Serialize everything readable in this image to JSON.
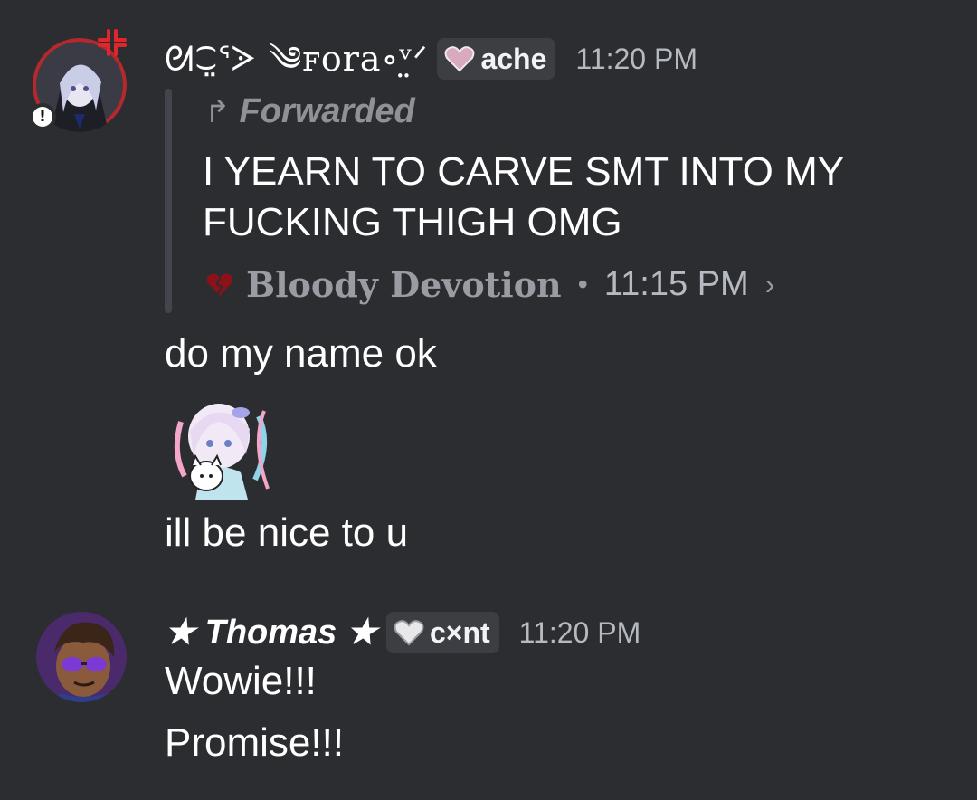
{
  "messages": [
    {
      "username": "ᘛ⁐̤ᕐᐷ ༄ꜰora∘ᵛ̤ᐟ",
      "role_tag": "ache",
      "tag_color": "#d8aabd",
      "timestamp": "11:20 PM",
      "forwarded": {
        "label": "Forwarded",
        "text": "I YEARN TO CARVE SMT INTO MY FUCKING THIGH OMG",
        "source_name": "Bloody Devotion",
        "source_separator": "•",
        "source_time": "11:15 PM",
        "source_chevron": "›",
        "source_icon": "broken-heart-icon"
      },
      "lines": [
        "do my name ok",
        "ill be nice to u"
      ],
      "sticker": "anime-girl-with-cat-sticker",
      "status_icon": "exclamation-icon"
    },
    {
      "username": "★ Thomas ★",
      "role_tag": "c×nt",
      "tag_color": "#e8e8ea",
      "timestamp": "11:20 PM",
      "lines": [
        "Wowie!!!",
        "Promise!!!"
      ]
    }
  ],
  "colors": {
    "background": "#2c2d31",
    "tag_background": "#3d3e44",
    "timestamp": "#b5bac1",
    "muted": "#9a9ca3"
  }
}
